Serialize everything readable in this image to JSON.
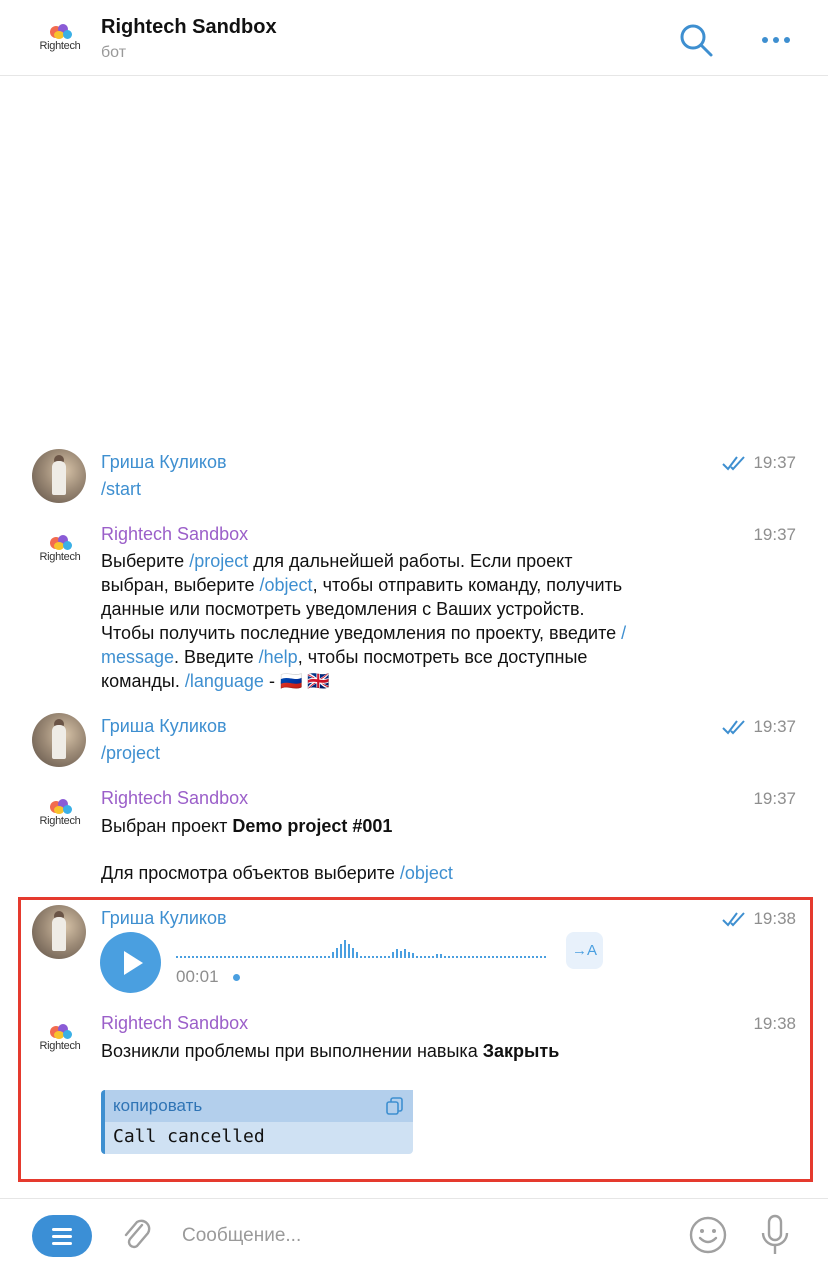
{
  "header": {
    "title": "Rightech Sandbox",
    "subtitle": "бот",
    "logo_text": "Rightech"
  },
  "messages": [
    {
      "sender": "Гриша Куликов",
      "time": "19:37",
      "text": "/start"
    },
    {
      "sender": "Rightech Sandbox",
      "time": "19:37",
      "parts": [
        "Выберите ",
        "/project",
        " для дальнейшей работы. Если проект",
        "выбран, выберите ",
        "/object",
        ", чтобы отправить команду, получить",
        "данные или посмотреть уведомления с Ваших устройств.",
        "Чтобы получить последние уведомления по проекту, введите ",
        "/",
        "message",
        ". Введите ",
        "/help",
        ", чтобы посмотреть все доступные",
        "команды. ",
        "/language",
        " - ",
        "🇷🇺 🇬🇧"
      ]
    },
    {
      "sender": "Гриша Куликов",
      "time": "19:37",
      "text": "/project"
    },
    {
      "sender": "Rightech Sandbox",
      "time": "19:37",
      "line1": "Выбран проект ",
      "project": "Demo project #001",
      "line2": "Для просмотра объектов выберите ",
      "cmd": "/object"
    },
    {
      "sender": "Гриша Куликов",
      "time": "19:38",
      "voice_duration": "00:01",
      "transcribe_label": "→A"
    },
    {
      "sender": "Rightech Sandbox",
      "time": "19:38",
      "text": "Возникли проблемы при выполнении навыка ",
      "skill": "Закрыть",
      "code_label": "копировать",
      "code_text": "Call cancelled"
    }
  ],
  "input": {
    "placeholder": "Сообщение..."
  },
  "colors": {
    "accent": "#3e8fd0",
    "bot_name": "#9b5fc9",
    "highlight": "#e53a2e"
  }
}
